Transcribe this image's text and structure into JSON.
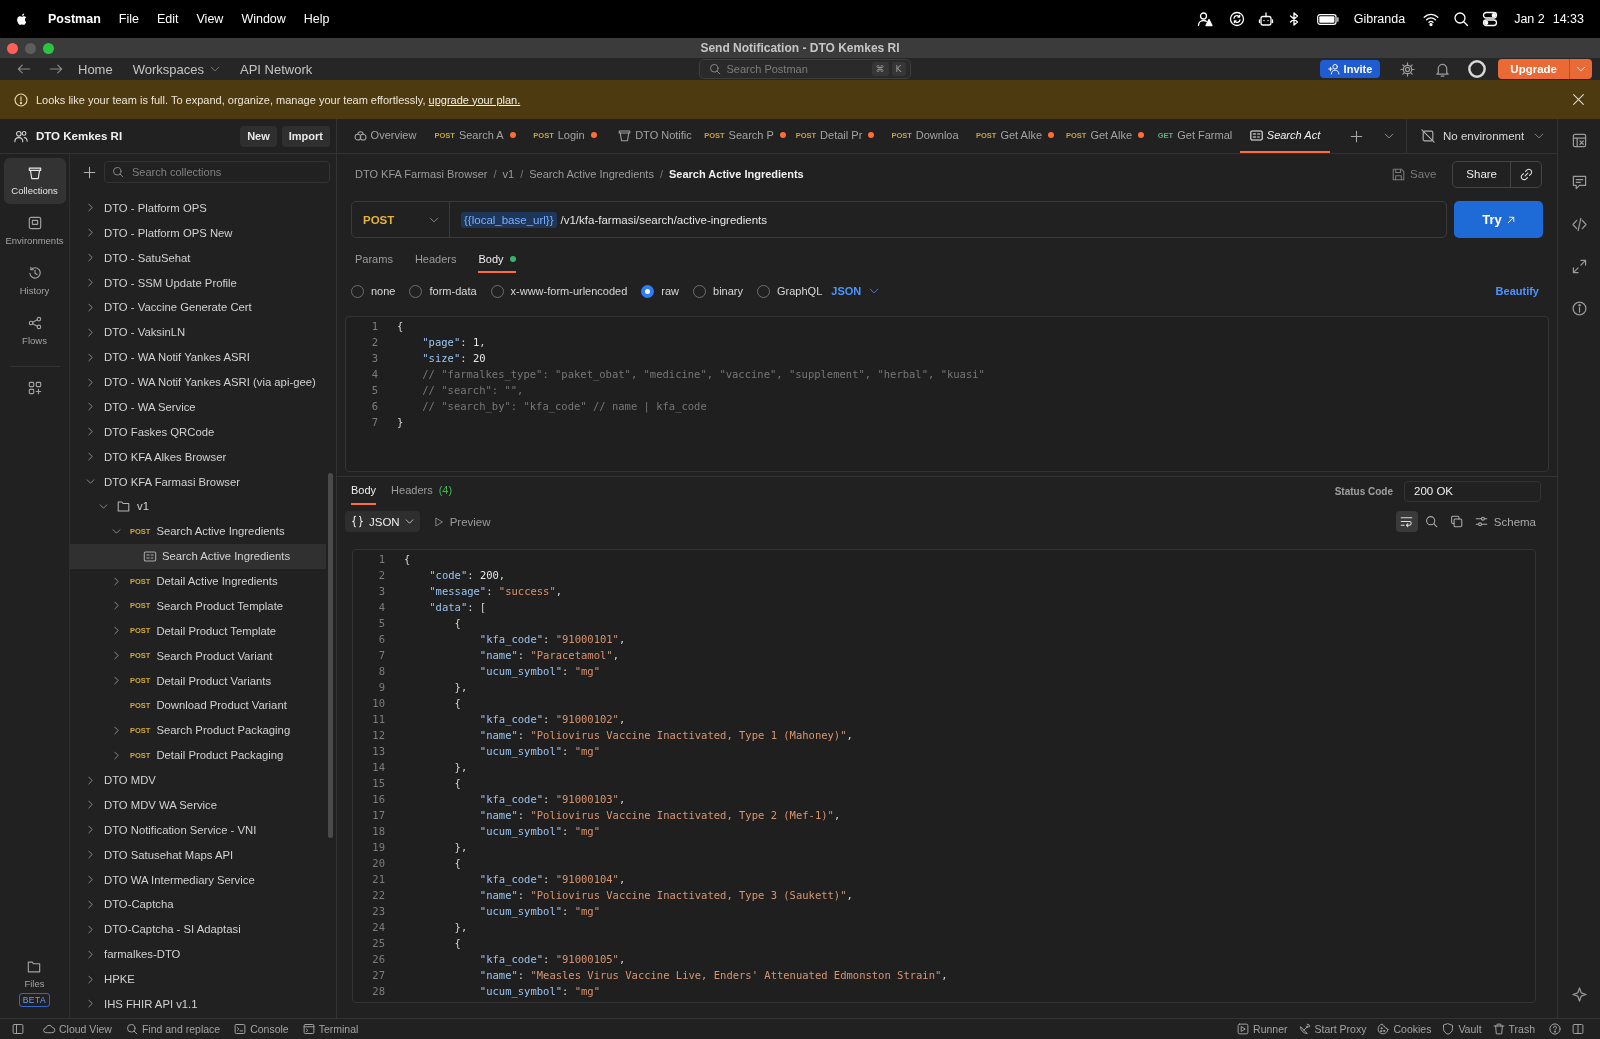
{
  "menu_bar": {
    "app_name": "Postman",
    "menus": [
      "File",
      "Edit",
      "View",
      "Window",
      "Help"
    ],
    "user_name": "Gibranda",
    "date": "Jan 2",
    "time": "14:33"
  },
  "window": {
    "title": "Send Notification - DTO Kemkes RI"
  },
  "header": {
    "nav": [
      {
        "label": "Home",
        "dropdown": false
      },
      {
        "label": "Workspaces",
        "dropdown": true
      },
      {
        "label": "API Network",
        "dropdown": false
      }
    ],
    "search": {
      "placeholder": "Search Postman",
      "shortcut": [
        "⌘",
        "K"
      ]
    },
    "invite": "Invite",
    "upgrade": "Upgrade"
  },
  "banner": {
    "message": "Looks like your team is full. To expand, organize, manage your team effortlessly,",
    "link": "upgrade your plan."
  },
  "workspace": {
    "name": "DTO Kemkes RI",
    "buttons": [
      "New",
      "Import"
    ]
  },
  "nav_rail": {
    "items": [
      {
        "kind": "collections",
        "label": "Collections",
        "selected": true
      },
      {
        "kind": "environments",
        "label": "Environments",
        "selected": false
      },
      {
        "kind": "history",
        "label": "History",
        "selected": false
      },
      {
        "kind": "flows",
        "label": "Flows",
        "selected": false
      }
    ],
    "files": {
      "label": "Files",
      "badge": "BETA"
    }
  },
  "sidebar": {
    "search": {
      "placeholder": "Search collections"
    },
    "tree": [
      {
        "label": "DTO - Platform OPS",
        "expanded": false,
        "selected": false
      },
      {
        "label": "DTO - Platform OPS New",
        "expanded": false,
        "selected": false
      },
      {
        "label": "DTO - SatuSehat",
        "expanded": false,
        "selected": false
      },
      {
        "label": "DTO - SSM Update Profile",
        "expanded": false,
        "selected": false
      },
      {
        "label": "DTO - Vaccine Generate Cert",
        "expanded": false,
        "selected": false
      },
      {
        "label": "DTO - VaksinLN",
        "expanded": false,
        "selected": false
      },
      {
        "label": "DTO - WA Notif Yankes ASRI",
        "expanded": false,
        "selected": false
      },
      {
        "label": "DTO - WA Notif Yankes ASRI (via api-gee)",
        "expanded": false,
        "selected": false
      },
      {
        "label": "DTO - WA Service",
        "expanded": false,
        "selected": false
      },
      {
        "label": "DTO Faskes QRCode",
        "expanded": false,
        "selected": false
      },
      {
        "label": "DTO KFA Alkes Browser",
        "expanded": false,
        "selected": false
      },
      {
        "label": "DTO KFA Farmasi Browser",
        "expanded": true,
        "selected": false,
        "children": [
          {
            "kind": "folder",
            "label": "v1",
            "expanded": true,
            "selected": false,
            "children": [
              {
                "kind": "request",
                "method": {
                  "name": "POST",
                  "color": "#d1a93a"
                },
                "label": "Search Active Ingredients",
                "expanded": true,
                "selected": false,
                "children": [
                  {
                    "kind": "example",
                    "label": "Search Active Ingredients",
                    "selected": true
                  }
                ]
              },
              {
                "kind": "request",
                "method": {
                  "name": "POST",
                  "color": "#d1a93a"
                },
                "label": "Detail Active Ingredients",
                "expanded": false,
                "selected": false
              },
              {
                "kind": "request",
                "method": {
                  "name": "POST",
                  "color": "#d1a93a"
                },
                "label": "Search Product Template",
                "expanded": false,
                "selected": false
              },
              {
                "kind": "request",
                "method": {
                  "name": "POST",
                  "color": "#d1a93a"
                },
                "label": "Detail Product Template",
                "expanded": false,
                "selected": false
              },
              {
                "kind": "request",
                "method": {
                  "name": "POST",
                  "color": "#d1a93a"
                },
                "label": "Search Product Variant",
                "expanded": false,
                "selected": false
              },
              {
                "kind": "request",
                "method": {
                  "name": "POST",
                  "color": "#d1a93a"
                },
                "label": "Detail Product Variants",
                "expanded": false,
                "selected": false
              },
              {
                "kind": "request",
                "method": {
                  "name": "POST",
                  "color": "#d1a93a"
                },
                "label": "Download Product Variant",
                "selected": false
              },
              {
                "kind": "request",
                "method": {
                  "name": "POST",
                  "color": "#d1a93a"
                },
                "label": "Search Product Packaging",
                "expanded": false,
                "selected": false
              },
              {
                "kind": "request",
                "method": {
                  "name": "POST",
                  "color": "#d1a93a"
                },
                "label": "Detail Product Packaging",
                "expanded": false,
                "selected": false
              }
            ]
          }
        ]
      },
      {
        "label": "DTO MDV",
        "expanded": false,
        "selected": false
      },
      {
        "label": "DTO MDV WA Service",
        "expanded": false,
        "selected": false
      },
      {
        "label": "DTO Notification Service - VNI",
        "expanded": false,
        "selected": false
      },
      {
        "label": "DTO Satusehat Maps API",
        "expanded": false,
        "selected": false
      },
      {
        "label": "DTO WA Intermediary Service",
        "expanded": false,
        "selected": false
      },
      {
        "label": "DTO-Captcha",
        "expanded": false,
        "selected": false
      },
      {
        "label": "DTO-Captcha - SI Adaptasi",
        "expanded": false,
        "selected": false
      },
      {
        "label": "farmalkes-DTO",
        "expanded": false,
        "selected": false
      },
      {
        "label": "HPKE",
        "expanded": false,
        "selected": false
      },
      {
        "label": "IHS FHIR API v1.1",
        "expanded": false,
        "selected": false
      }
    ]
  },
  "tabs": [
    {
      "kind": "overview",
      "label": "Overview",
      "unsaved": false,
      "selected": false,
      "preview": false
    },
    {
      "kind": "request",
      "method": {
        "name": "POST",
        "color": "#c9a13c"
      },
      "label": "Search A",
      "unsaved": true,
      "selected": false,
      "preview": false
    },
    {
      "kind": "request",
      "method": {
        "name": "POST",
        "color": "#c9a13c"
      },
      "label": "Login",
      "unsaved": true,
      "selected": false,
      "preview": false
    },
    {
      "kind": "collection",
      "label": "DTO Notific",
      "unsaved": false,
      "selected": false,
      "preview": false
    },
    {
      "kind": "request",
      "method": {
        "name": "POST",
        "color": "#c9a13c"
      },
      "label": "Search P",
      "unsaved": true,
      "selected": false,
      "preview": false
    },
    {
      "kind": "request",
      "method": {
        "name": "POST",
        "color": "#c9a13c"
      },
      "label": "Detail Pr",
      "unsaved": true,
      "selected": false,
      "preview": false
    },
    {
      "kind": "request",
      "method": {
        "name": "POST",
        "color": "#c9a13c"
      },
      "label": "Downloa",
      "unsaved": false,
      "selected": false,
      "preview": false
    },
    {
      "kind": "request",
      "method": {
        "name": "POST",
        "color": "#c9a13c"
      },
      "label": "Get Alke",
      "unsaved": true,
      "selected": false,
      "preview": false
    },
    {
      "kind": "request",
      "method": {
        "name": "POST",
        "color": "#c9a13c"
      },
      "label": "Get Alke",
      "unsaved": true,
      "selected": false,
      "preview": false
    },
    {
      "kind": "request",
      "method": {
        "name": "GET",
        "color": "#5fae7e"
      },
      "label": "Get Farmal",
      "unsaved": false,
      "selected": false,
      "preview": false
    },
    {
      "kind": "example",
      "label": "Search Act",
      "unsaved": false,
      "selected": true,
      "preview": true
    }
  ],
  "environment": {
    "label": "No environment"
  },
  "breadcrumb": {
    "items": [
      "DTO KFA Farmasi Browser",
      "v1",
      "Search Active Ingredients",
      "Search Active Ingredients"
    ],
    "separator": "/"
  },
  "request": {
    "save": {
      "label": "Save",
      "disabled": true
    },
    "share": "Share",
    "method": "POST",
    "url": {
      "variable": "{{local_base_url}}",
      "path": "/v1/kfa-farmasi/search/active-ingredients"
    },
    "send": "Try",
    "tabs": [
      {
        "label": "Params",
        "selected": false,
        "has_content": false
      },
      {
        "label": "Headers",
        "selected": false,
        "has_content": false
      },
      {
        "label": "Body",
        "selected": true,
        "has_content": true
      }
    ],
    "body_types": [
      {
        "label": "none",
        "selected": false
      },
      {
        "label": "form-data",
        "selected": false
      },
      {
        "label": "x-www-form-urlencoded",
        "selected": false
      },
      {
        "label": "raw",
        "selected": true
      },
      {
        "label": "binary",
        "selected": false
      },
      {
        "label": "GraphQL",
        "selected": false
      }
    ],
    "language": "JSON",
    "beautify": "Beautify",
    "body_lines": [
      {
        "number": "1",
        "code": "{"
      },
      {
        "number": "2",
        "code": "    \"page\": 1,"
      },
      {
        "number": "3",
        "code": "    \"size\": 20"
      },
      {
        "number": "4",
        "code": "    // \"farmalkes_type\": \"paket_obat\", \"medicine\", \"vaccine\", \"supplement\", \"herbal\", \"kuasi\""
      },
      {
        "number": "5",
        "code": "    // \"search\": \"\","
      },
      {
        "number": "6",
        "code": "    // \"search_by\": \"kfa_code\" // name | kfa_code"
      },
      {
        "number": "7",
        "code": "}"
      }
    ]
  },
  "response": {
    "tabs": [
      {
        "label": "Body",
        "selected": true
      },
      {
        "label": "Headers",
        "count": "(4)",
        "selected": false
      }
    ],
    "status_label": "Status Code",
    "status": "200 OK",
    "format": "JSON",
    "preview": "Preview",
    "wrap_lines": true,
    "schema": "Schema",
    "lines": [
      {
        "number": "1",
        "code": "{"
      },
      {
        "number": "2",
        "code": "    \"code\": 200,"
      },
      {
        "number": "3",
        "code": "    \"message\": \"success\","
      },
      {
        "number": "4",
        "code": "    \"data\": ["
      },
      {
        "number": "5",
        "code": "        {"
      },
      {
        "number": "6",
        "code": "            \"kfa_code\": \"91000101\","
      },
      {
        "number": "7",
        "code": "            \"name\": \"Paracetamol\","
      },
      {
        "number": "8",
        "code": "            \"ucum_symbol\": \"mg\""
      },
      {
        "number": "9",
        "code": "        },"
      },
      {
        "number": "10",
        "code": "        {"
      },
      {
        "number": "11",
        "code": "            \"kfa_code\": \"91000102\","
      },
      {
        "number": "12",
        "code": "            \"name\": \"Poliovirus Vaccine Inactivated, Type 1 (Mahoney)\","
      },
      {
        "number": "13",
        "code": "            \"ucum_symbol\": \"mg\""
      },
      {
        "number": "14",
        "code": "        },"
      },
      {
        "number": "15",
        "code": "        {"
      },
      {
        "number": "16",
        "code": "            \"kfa_code\": \"91000103\","
      },
      {
        "number": "17",
        "code": "            \"name\": \"Poliovirus Vaccine Inactivated, Type 2 (Mef-1)\","
      },
      {
        "number": "18",
        "code": "            \"ucum_symbol\": \"mg\""
      },
      {
        "number": "19",
        "code": "        },"
      },
      {
        "number": "20",
        "code": "        {"
      },
      {
        "number": "21",
        "code": "            \"kfa_code\": \"91000104\","
      },
      {
        "number": "22",
        "code": "            \"name\": \"Poliovirus Vaccine Inactivated, Type 3 (Saukett)\","
      },
      {
        "number": "23",
        "code": "            \"ucum_symbol\": \"mg\""
      },
      {
        "number": "24",
        "code": "        },"
      },
      {
        "number": "25",
        "code": "        {"
      },
      {
        "number": "26",
        "code": "            \"kfa_code\": \"91000105\","
      },
      {
        "number": "27",
        "code": "            \"name\": \"Measles Virus Vaccine Live, Enders' Attenuated Edmonston Strain\","
      },
      {
        "number": "28",
        "code": "            \"ucum_symbol\": \"mg\""
      }
    ]
  },
  "status_bar": {
    "left": [
      {
        "kind": "cloud",
        "label": "Cloud View"
      },
      {
        "kind": "search",
        "label": "Find and replace"
      },
      {
        "kind": "console",
        "label": "Console"
      },
      {
        "kind": "terminal",
        "label": "Terminal"
      }
    ],
    "right": [
      {
        "kind": "runner",
        "label": "Runner"
      },
      {
        "kind": "proxy",
        "label": "Start Proxy"
      },
      {
        "kind": "cookies",
        "label": "Cookies"
      },
      {
        "kind": "vault",
        "label": "Vault"
      },
      {
        "kind": "trash",
        "label": "Trash"
      }
    ]
  }
}
